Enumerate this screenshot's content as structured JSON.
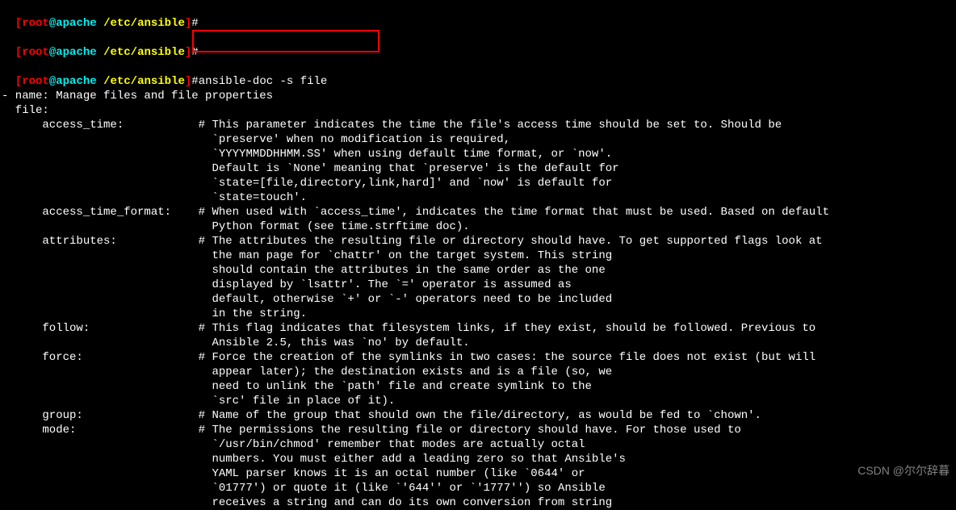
{
  "prompts": [
    {
      "lb": "[",
      "user": "root",
      "at": "@",
      "host": "apache",
      "sp": " ",
      "path": "/etc/ansible",
      "rb": "]",
      "hash": "#",
      "cmd": ""
    },
    {
      "lb": "[",
      "user": "root",
      "at": "@",
      "host": "apache",
      "sp": " ",
      "path": "/etc/ansible",
      "rb": "]",
      "hash": "#",
      "cmd": ""
    },
    {
      "lb": "[",
      "user": "root",
      "at": "@",
      "host": "apache",
      "sp": " ",
      "path": "/etc/ansible",
      "rb": "]",
      "hash": "#",
      "cmd": "ansible-doc -s file"
    }
  ],
  "doc_lines": [
    "- name: Manage files and file properties",
    "  file:",
    "      access_time:           # This parameter indicates the time the file's access time should be set to. Should be",
    "                               `preserve' when no modification is required,",
    "                               `YYYYMMDDHHMM.SS' when using default time format, or `now'.",
    "                               Default is `None' meaning that `preserve' is the default for",
    "                               `state=[file,directory,link,hard]' and `now' is default for",
    "                               `state=touch'.",
    "      access_time_format:    # When used with `access_time', indicates the time format that must be used. Based on default",
    "                               Python format (see time.strftime doc).",
    "      attributes:            # The attributes the resulting file or directory should have. To get supported flags look at",
    "                               the man page for `chattr' on the target system. This string",
    "                               should contain the attributes in the same order as the one",
    "                               displayed by `lsattr'. The `=' operator is assumed as",
    "                               default, otherwise `+' or `-' operators need to be included",
    "                               in the string.",
    "      follow:                # This flag indicates that filesystem links, if they exist, should be followed. Previous to",
    "                               Ansible 2.5, this was `no' by default.",
    "      force:                 # Force the creation of the symlinks in two cases: the source file does not exist (but will",
    "                               appear later); the destination exists and is a file (so, we",
    "                               need to unlink the `path' file and create symlink to the",
    "                               `src' file in place of it).",
    "      group:                 # Name of the group that should own the file/directory, as would be fed to `chown'.",
    "      mode:                  # The permissions the resulting file or directory should have. For those used to",
    "                               `/usr/bin/chmod' remember that modes are actually octal",
    "                               numbers. You must either add a leading zero so that Ansible's",
    "                               YAML parser knows it is an octal number (like `0644' or",
    "                               `01777') or quote it (like `'644'' or `'1777'') so Ansible",
    "                               receives a string and can do its own conversion from string"
  ],
  "watermark": "CSDN @尔尔辞暮"
}
